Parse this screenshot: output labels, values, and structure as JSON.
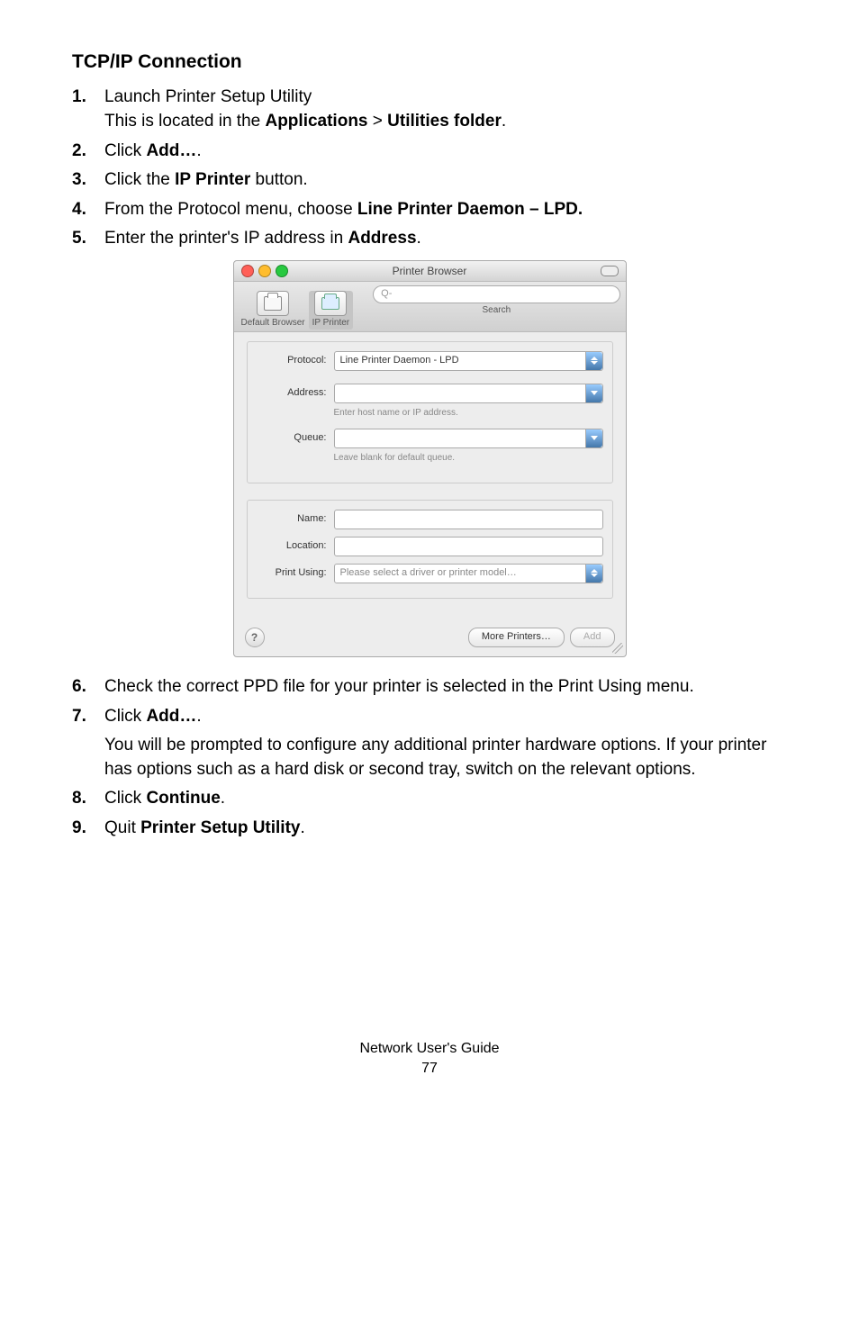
{
  "heading": "TCP/IP Connection",
  "steps": {
    "s1a": "Launch Printer Setup Utility",
    "s1b_prefix": "This is located in the ",
    "s1b_b1": "Applications",
    "s1b_mid": " > ",
    "s1b_b2": "Utilities folder",
    "s1b_suffix": ".",
    "s2_prefix": "Click ",
    "s2_b": "Add…",
    "s2_suffix": ".",
    "s3_prefix": "Click the ",
    "s3_b": "IP Printer",
    "s3_suffix": " button.",
    "s4_prefix": "From the Protocol menu, choose ",
    "s4_b": "Line Printer Daemon – LPD.",
    "s5_prefix": "Enter the printer's IP address in ",
    "s5_b": "Address",
    "s5_suffix": ".",
    "s6": "Check the correct PPD file for your printer is selected in the Print Using menu.",
    "s7_prefix": "Click ",
    "s7_b": "Add…",
    "s7_suffix": ".",
    "s7_body": "You will be prompted to configure any additional printer hardware options. If your printer has options such as a hard disk or second tray, switch on the relevant options.",
    "s8_prefix": "Click ",
    "s8_b": "Continue",
    "s8_suffix": ".",
    "s9_prefix": "Quit ",
    "s9_b": "Printer Setup Utility",
    "s9_suffix": "."
  },
  "markers": {
    "m1": "1.",
    "m2": "2.",
    "m3": "3.",
    "m4": "4.",
    "m5": "5.",
    "m6": "6.",
    "m7": "7.",
    "m8": "8.",
    "m9": "9."
  },
  "window": {
    "title": "Printer Browser",
    "toolbar": {
      "default_browser": "Default Browser",
      "ip_printer": "IP Printer",
      "search_glyph": "Q-",
      "search_label": "Search"
    },
    "form": {
      "protocol_label": "Protocol:",
      "protocol_value": "Line Printer Daemon - LPD",
      "address_label": "Address:",
      "address_hint": "Enter host name or IP address.",
      "queue_label": "Queue:",
      "queue_hint": "Leave blank for default queue.",
      "name_label": "Name:",
      "location_label": "Location:",
      "print_using_label": "Print Using:",
      "print_using_value": "Please select a driver or printer model…"
    },
    "buttons": {
      "help": "?",
      "more_printers": "More Printers…",
      "add": "Add"
    }
  },
  "footer": {
    "guide": "Network User's Guide",
    "page": "77"
  }
}
